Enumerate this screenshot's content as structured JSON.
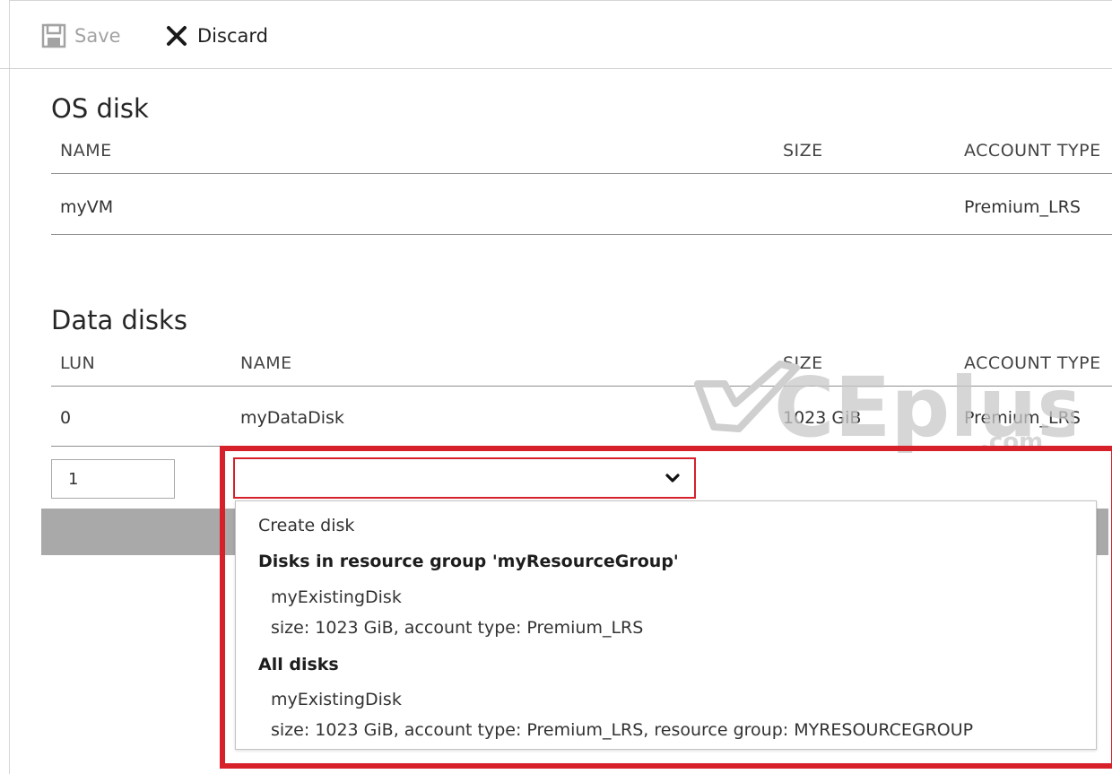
{
  "toolbar": {
    "save_label": "Save",
    "discard_label": "Discard",
    "save_icon": "save-icon",
    "discard_icon": "close-icon"
  },
  "os_disk": {
    "title": "OS disk",
    "headers": {
      "name": "NAME",
      "size": "SIZE",
      "account_type": "ACCOUNT TYPE"
    },
    "row": {
      "name": "myVM",
      "size": "",
      "account_type": "Premium_LRS"
    }
  },
  "data_disks": {
    "title": "Data disks",
    "headers": {
      "lun": "LUN",
      "name": "NAME",
      "size": "SIZE",
      "account_type": "ACCOUNT TYPE"
    },
    "rows": [
      {
        "lun": "0",
        "name": "myDataDisk",
        "size": "1023 GiB",
        "account_type": "Premium_LRS"
      }
    ],
    "new_row": {
      "lun_value": "1",
      "name_selected": ""
    }
  },
  "dropdown": {
    "create_label": "Create disk",
    "group_resource": "Disks in resource group 'myResourceGroup'",
    "group_resource_items": [
      {
        "name": "myExistingDisk",
        "detail": "size: 1023 GiB, account type: Premium_LRS"
      }
    ],
    "group_all": "All disks",
    "group_all_items": [
      {
        "name": "myExistingDisk",
        "detail": "size: 1023 GiB, account type: Premium_LRS, resource group: MYRESOURCEGROUP"
      }
    ]
  },
  "watermark": {
    "text": "CEplus",
    "suffix": ".com"
  },
  "colors": {
    "highlight": "#d6212b",
    "grey_bar": "#a9a9a9",
    "disabled_text": "#a3a3a3"
  }
}
